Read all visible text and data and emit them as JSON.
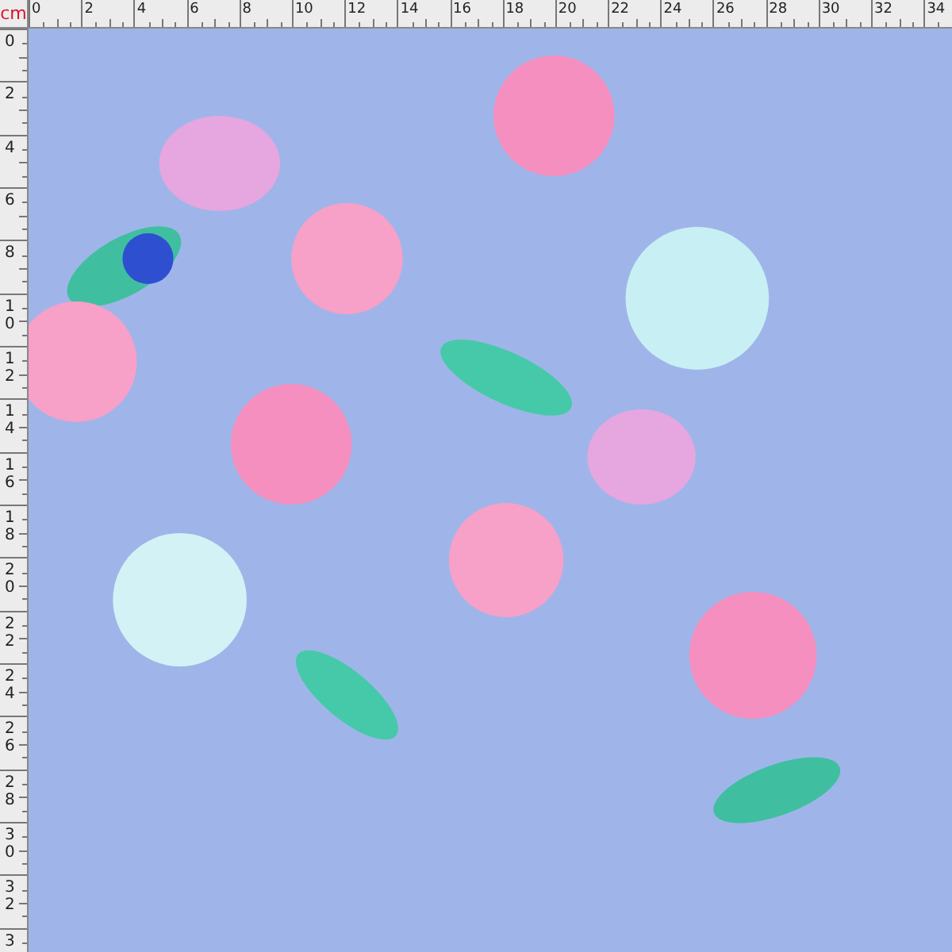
{
  "ruler": {
    "unit": "cm",
    "top_labels": [
      "0",
      "2",
      "4",
      "6",
      "8",
      "10",
      "12",
      "14",
      "16",
      "18",
      "20",
      "22",
      "24",
      "26",
      "28",
      "30",
      "32",
      "34"
    ],
    "left_labels": [
      "0",
      "2",
      "4",
      "6",
      "8",
      "10",
      "12",
      "14",
      "16",
      "18",
      "20",
      "22",
      "24",
      "26",
      "28",
      "30",
      "32",
      "3"
    ]
  }
}
